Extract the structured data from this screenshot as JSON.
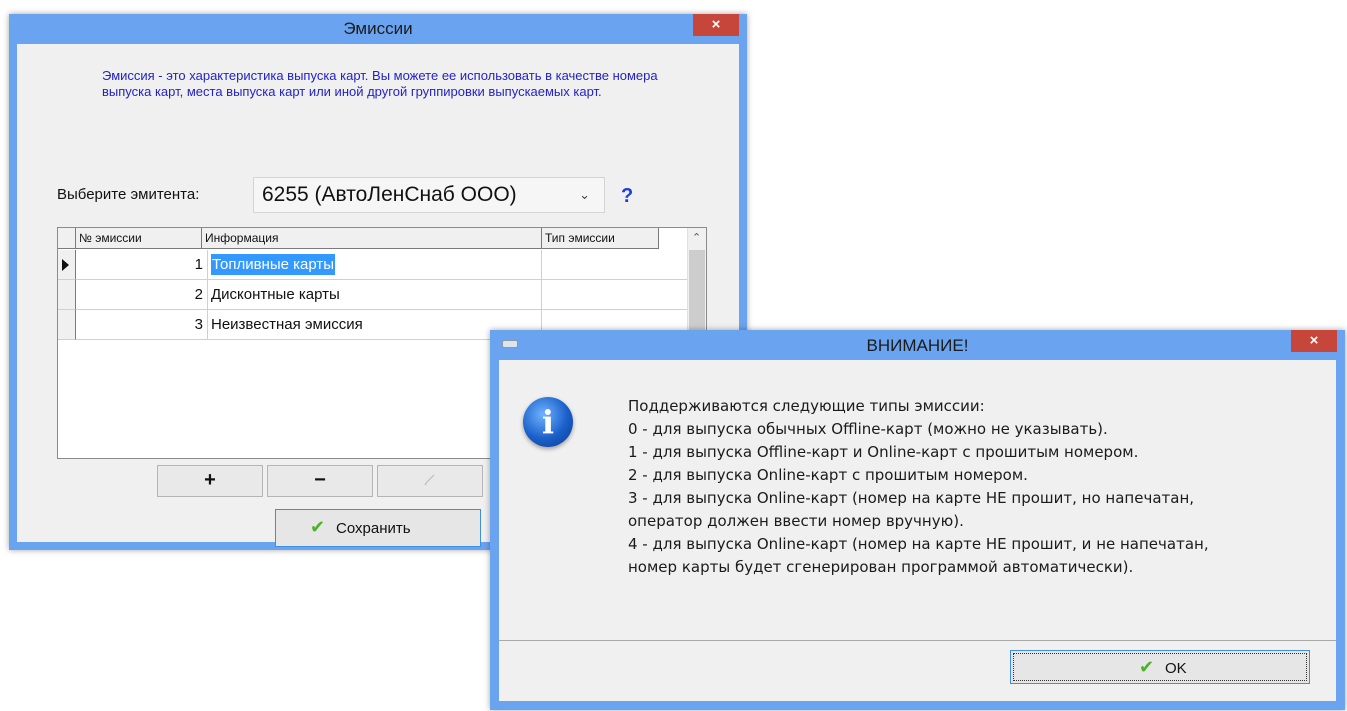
{
  "main_window": {
    "title": "Эмиссии",
    "close_glyph": "×",
    "intro_text": "Эмиссия - это характеристика выпуска карт. Вы можете ее использовать в качестве номера выпуска карт, места выпуска карт или иной другой группировки выпускаемых карт.",
    "emitter_label": "Выберите эмитента:",
    "emitter_value": "6255 (АвтоЛенСнаб ООО)",
    "help_glyph": "?",
    "grid": {
      "columns": [
        "№ эмиссии",
        "Информация",
        "Тип эмиссии"
      ],
      "rows": [
        {
          "num": "1",
          "info": "Топливные карты",
          "type": ""
        },
        {
          "num": "2",
          "info": "Дисконтные карты",
          "type": ""
        },
        {
          "num": "3",
          "info": "Неизвестная эмиссия",
          "type": ""
        }
      ]
    },
    "toolbar": {
      "add": "+",
      "remove": "−",
      "edit_icon": "pencil-icon"
    },
    "save_label": "Сохранить"
  },
  "alert_window": {
    "title": "ВНИМАНИЕ!",
    "close_glyph": "×",
    "icon": "info-icon",
    "message_lines": [
      "Поддерживаются следующие типы эмиссии:",
      "0 - для выпуска обычных Offline-карт (можно не указывать).",
      "1 - для выпуска Offline-карт и Online-карт с прошитым номером.",
      "2 - для выпуска Online-карт с прошитым номером.",
      "3 - для выпуска Online-карт (номер на карте НЕ прошит, но напечатан,",
      "оператор должен ввести номер вручную).",
      "4 - для выпуска Online-карт (номер на карте НЕ прошит, и не напечатан,",
      "номер карты будет сгенерирован программой автоматически)."
    ],
    "ok_label": "OK"
  },
  "colors": {
    "window_frame": "#6aa3f0",
    "close_button": "#c7463b",
    "intro_text": "#2323c8",
    "selection": "#3399ff",
    "check_icon": "#4bb32a"
  }
}
